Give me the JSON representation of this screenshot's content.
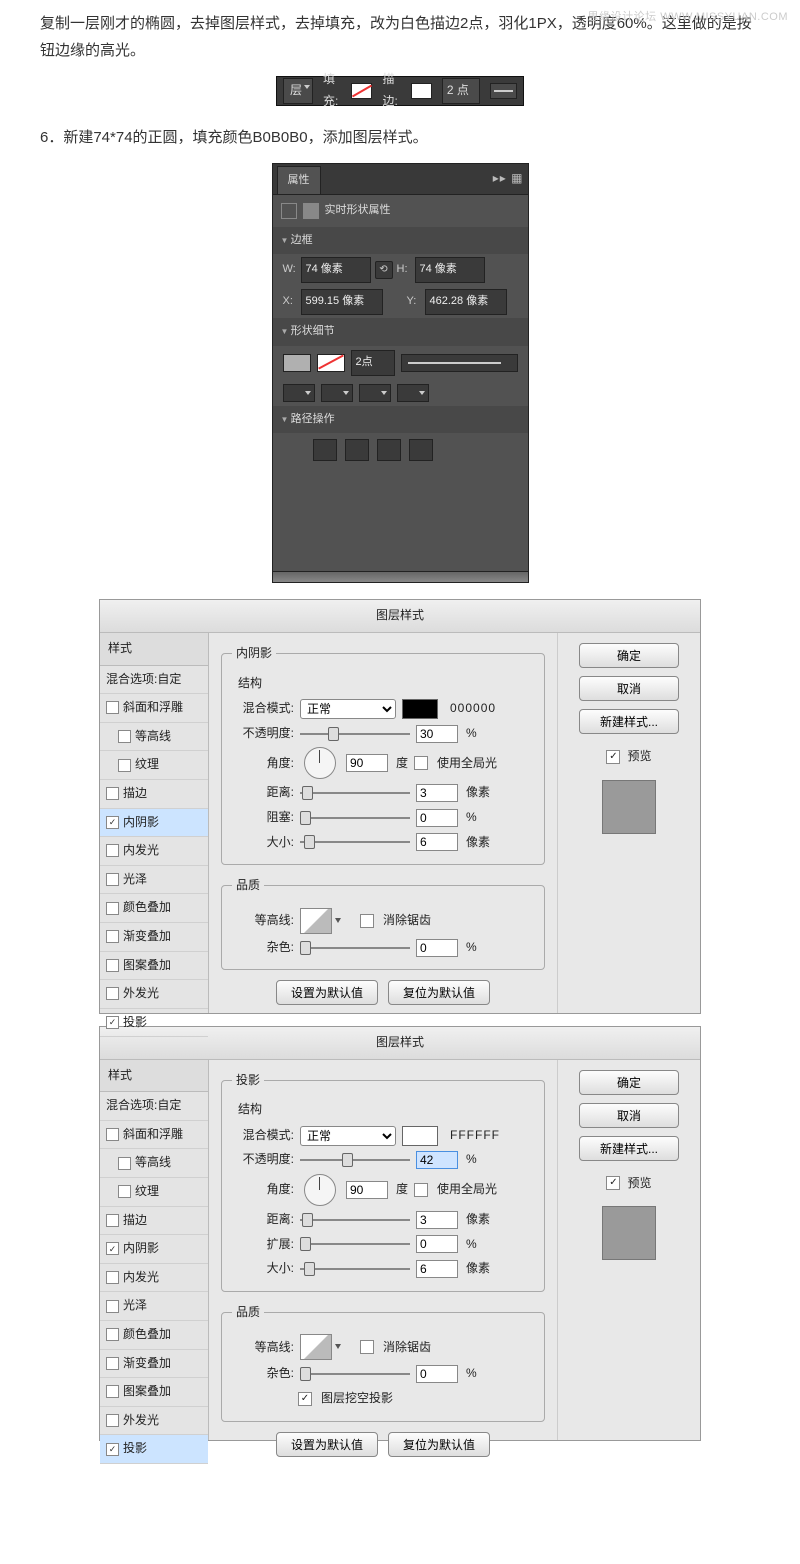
{
  "watermark": "思缘设计论坛   WWW.MISSYUAN.COM",
  "paragraphs": {
    "p1": "复制一层刚才的椭圆，去掉图层样式，去掉填充，改为白色描边2点，羽化1PX，透明度60%。这里做的是按钮边缘的高光。",
    "p2": "6．新建74*74的正圆，填充颜色B0B0B0，添加图层样式。"
  },
  "toolbar": {
    "layer_suffix": "层",
    "fill_label": "填充:",
    "stroke_label": "描边:",
    "stroke_size": "2 点"
  },
  "properties_panel": {
    "tab": "属性",
    "header": "实时形状属性",
    "section_border": "边框",
    "w_label": "W:",
    "w_value": "74 像素",
    "h_label": "H:",
    "h_value": "74 像素",
    "x_label": "X:",
    "x_value": "599.15 像素",
    "y_label": "Y:",
    "y_value": "462.28 像素",
    "section_detail": "形状细节",
    "stroke_width": "2点",
    "section_path": "路径操作"
  },
  "style_list": {
    "header": "样式",
    "blend": "混合选项:自定",
    "bevel": "斜面和浮雕",
    "contour": "等高线",
    "texture": "纹理",
    "stroke": "描边",
    "inner_shadow": "内阴影",
    "inner_glow": "内发光",
    "satin": "光泽",
    "color_overlay": "颜色叠加",
    "grad_overlay": "渐变叠加",
    "pattern_overlay": "图案叠加",
    "outer_glow": "外发光",
    "drop_shadow": "投影"
  },
  "dialog_common": {
    "title": "图层样式",
    "blend_mode_label": "混合模式:",
    "blend_mode_value": "正常",
    "opacity_label": "不透明度:",
    "angle_label": "角度:",
    "angle_unit": "度",
    "global_light": "使用全局光",
    "distance_label": "距离:",
    "size_label": "大小:",
    "px_unit": "像素",
    "quality_legend": "品质",
    "contour_label": "等高线:",
    "antialias": "消除锯齿",
    "noise_label": "杂色:",
    "set_default": "设置为默认值",
    "reset_default": "复位为默认值",
    "ok": "确定",
    "cancel": "取消",
    "new_style": "新建样式...",
    "preview": "预览"
  },
  "dialog1": {
    "section_label": "内阴影",
    "legend": "结构",
    "color_hex": "000000",
    "opacity": "30",
    "angle": "90",
    "distance": "3",
    "choke_label": "阻塞:",
    "choke": "0",
    "size": "6",
    "noise": "0",
    "checked": {
      "inner_shadow": true,
      "drop_shadow": true
    }
  },
  "dialog2": {
    "section_label": "投影",
    "legend": "结构",
    "color_hex": "FFFFFF",
    "opacity": "42",
    "angle": "90",
    "distance": "3",
    "spread_label": "扩展:",
    "spread": "0",
    "size": "6",
    "noise": "0",
    "knockout": "图层挖空投影",
    "checked": {
      "inner_shadow": true,
      "drop_shadow": true
    }
  }
}
